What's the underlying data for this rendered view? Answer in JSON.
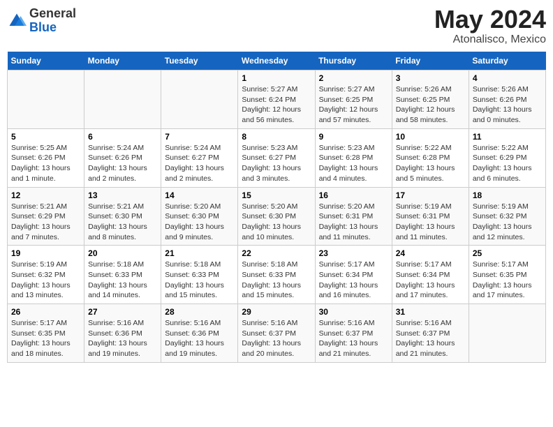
{
  "header": {
    "logo_general": "General",
    "logo_blue": "Blue",
    "month_title": "May 2024",
    "location": "Atonalisco, Mexico"
  },
  "days_of_week": [
    "Sunday",
    "Monday",
    "Tuesday",
    "Wednesday",
    "Thursday",
    "Friday",
    "Saturday"
  ],
  "weeks": [
    [
      {
        "day": "",
        "text": ""
      },
      {
        "day": "",
        "text": ""
      },
      {
        "day": "",
        "text": ""
      },
      {
        "day": "1",
        "text": "Sunrise: 5:27 AM\nSunset: 6:24 PM\nDaylight: 12 hours and 56 minutes."
      },
      {
        "day": "2",
        "text": "Sunrise: 5:27 AM\nSunset: 6:25 PM\nDaylight: 12 hours and 57 minutes."
      },
      {
        "day": "3",
        "text": "Sunrise: 5:26 AM\nSunset: 6:25 PM\nDaylight: 12 hours and 58 minutes."
      },
      {
        "day": "4",
        "text": "Sunrise: 5:26 AM\nSunset: 6:26 PM\nDaylight: 13 hours and 0 minutes."
      }
    ],
    [
      {
        "day": "5",
        "text": "Sunrise: 5:25 AM\nSunset: 6:26 PM\nDaylight: 13 hours and 1 minute."
      },
      {
        "day": "6",
        "text": "Sunrise: 5:24 AM\nSunset: 6:26 PM\nDaylight: 13 hours and 2 minutes."
      },
      {
        "day": "7",
        "text": "Sunrise: 5:24 AM\nSunset: 6:27 PM\nDaylight: 13 hours and 2 minutes."
      },
      {
        "day": "8",
        "text": "Sunrise: 5:23 AM\nSunset: 6:27 PM\nDaylight: 13 hours and 3 minutes."
      },
      {
        "day": "9",
        "text": "Sunrise: 5:23 AM\nSunset: 6:28 PM\nDaylight: 13 hours and 4 minutes."
      },
      {
        "day": "10",
        "text": "Sunrise: 5:22 AM\nSunset: 6:28 PM\nDaylight: 13 hours and 5 minutes."
      },
      {
        "day": "11",
        "text": "Sunrise: 5:22 AM\nSunset: 6:29 PM\nDaylight: 13 hours and 6 minutes."
      }
    ],
    [
      {
        "day": "12",
        "text": "Sunrise: 5:21 AM\nSunset: 6:29 PM\nDaylight: 13 hours and 7 minutes."
      },
      {
        "day": "13",
        "text": "Sunrise: 5:21 AM\nSunset: 6:30 PM\nDaylight: 13 hours and 8 minutes."
      },
      {
        "day": "14",
        "text": "Sunrise: 5:20 AM\nSunset: 6:30 PM\nDaylight: 13 hours and 9 minutes."
      },
      {
        "day": "15",
        "text": "Sunrise: 5:20 AM\nSunset: 6:30 PM\nDaylight: 13 hours and 10 minutes."
      },
      {
        "day": "16",
        "text": "Sunrise: 5:20 AM\nSunset: 6:31 PM\nDaylight: 13 hours and 11 minutes."
      },
      {
        "day": "17",
        "text": "Sunrise: 5:19 AM\nSunset: 6:31 PM\nDaylight: 13 hours and 11 minutes."
      },
      {
        "day": "18",
        "text": "Sunrise: 5:19 AM\nSunset: 6:32 PM\nDaylight: 13 hours and 12 minutes."
      }
    ],
    [
      {
        "day": "19",
        "text": "Sunrise: 5:19 AM\nSunset: 6:32 PM\nDaylight: 13 hours and 13 minutes."
      },
      {
        "day": "20",
        "text": "Sunrise: 5:18 AM\nSunset: 6:33 PM\nDaylight: 13 hours and 14 minutes."
      },
      {
        "day": "21",
        "text": "Sunrise: 5:18 AM\nSunset: 6:33 PM\nDaylight: 13 hours and 15 minutes."
      },
      {
        "day": "22",
        "text": "Sunrise: 5:18 AM\nSunset: 6:33 PM\nDaylight: 13 hours and 15 minutes."
      },
      {
        "day": "23",
        "text": "Sunrise: 5:17 AM\nSunset: 6:34 PM\nDaylight: 13 hours and 16 minutes."
      },
      {
        "day": "24",
        "text": "Sunrise: 5:17 AM\nSunset: 6:34 PM\nDaylight: 13 hours and 17 minutes."
      },
      {
        "day": "25",
        "text": "Sunrise: 5:17 AM\nSunset: 6:35 PM\nDaylight: 13 hours and 17 minutes."
      }
    ],
    [
      {
        "day": "26",
        "text": "Sunrise: 5:17 AM\nSunset: 6:35 PM\nDaylight: 13 hours and 18 minutes."
      },
      {
        "day": "27",
        "text": "Sunrise: 5:16 AM\nSunset: 6:36 PM\nDaylight: 13 hours and 19 minutes."
      },
      {
        "day": "28",
        "text": "Sunrise: 5:16 AM\nSunset: 6:36 PM\nDaylight: 13 hours and 19 minutes."
      },
      {
        "day": "29",
        "text": "Sunrise: 5:16 AM\nSunset: 6:37 PM\nDaylight: 13 hours and 20 minutes."
      },
      {
        "day": "30",
        "text": "Sunrise: 5:16 AM\nSunset: 6:37 PM\nDaylight: 13 hours and 21 minutes."
      },
      {
        "day": "31",
        "text": "Sunrise: 5:16 AM\nSunset: 6:37 PM\nDaylight: 13 hours and 21 minutes."
      },
      {
        "day": "",
        "text": ""
      }
    ]
  ]
}
